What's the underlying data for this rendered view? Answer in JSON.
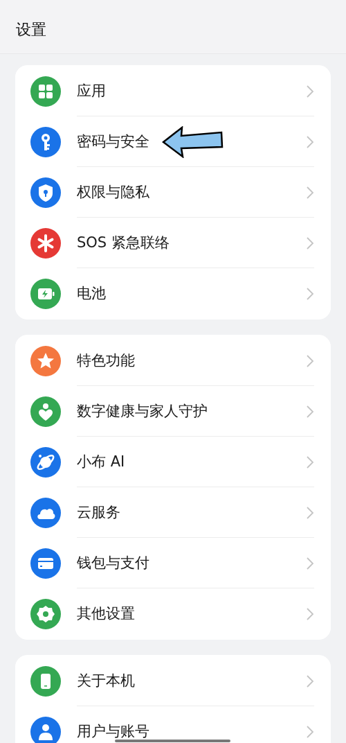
{
  "header": {
    "title": "设置"
  },
  "groups": [
    {
      "items": [
        {
          "label": "应用",
          "kind": "apps",
          "color": "#34a853"
        },
        {
          "label": "密码与安全",
          "kind": "key",
          "color": "#1a73e8",
          "annotated": true
        },
        {
          "label": "权限与隐私",
          "kind": "shield",
          "color": "#1a73e8"
        },
        {
          "label": "SOS 紧急联络",
          "kind": "asterisk",
          "color": "#e53935"
        },
        {
          "label": "电池",
          "kind": "battery",
          "color": "#34a853"
        }
      ]
    },
    {
      "items": [
        {
          "label": "特色功能",
          "kind": "star",
          "color": "#f4773f"
        },
        {
          "label": "数字健康与家人守护",
          "kind": "heart",
          "color": "#34a853"
        },
        {
          "label": "小布 AI",
          "kind": "orbit",
          "color": "#1a73e8"
        },
        {
          "label": "云服务",
          "kind": "cloud",
          "color": "#1a73e8"
        },
        {
          "label": "钱包与支付",
          "kind": "card",
          "color": "#1a73e8"
        },
        {
          "label": "其他设置",
          "kind": "gear",
          "color": "#34a853"
        }
      ]
    },
    {
      "items": [
        {
          "label": "关于本机",
          "kind": "phone",
          "color": "#34a853"
        },
        {
          "label": "用户与账号",
          "kind": "person",
          "color": "#1a73e8"
        }
      ]
    }
  ]
}
